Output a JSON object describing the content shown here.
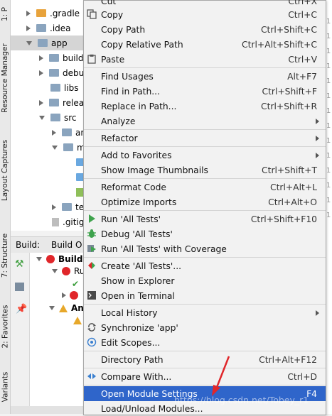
{
  "side_tabs": {
    "project": "1: P",
    "resource_manager": "Resource Manager",
    "layout_captures": "Layout Captures",
    "structure": "7: Structure",
    "favorites": "2: Favorites",
    "variants": "Variants"
  },
  "tree": {
    "items": [
      {
        "label": ".gradle",
        "folder": "orange",
        "arrow": "right"
      },
      {
        "label": ".idea",
        "folder": "gray",
        "arrow": "right"
      },
      {
        "label": "app",
        "folder": "gray",
        "arrow": "down"
      },
      {
        "label": "build",
        "folder": "gray",
        "arrow": "right"
      },
      {
        "label": "debu",
        "folder": "gray",
        "arrow": "right"
      },
      {
        "label": "libs",
        "folder": "gray",
        "arrow": "none"
      },
      {
        "label": "relea",
        "folder": "gray",
        "arrow": "right"
      },
      {
        "label": "src",
        "folder": "gray",
        "arrow": "down"
      },
      {
        "label": "an",
        "folder": "gray",
        "arrow": "right"
      },
      {
        "label": "m",
        "folder": "gray",
        "arrow": "down"
      },
      {
        "label": "te",
        "folder": "gray",
        "arrow": "right"
      },
      {
        "label": ".gitig",
        "folder": "file",
        "arrow": "none"
      }
    ]
  },
  "build": {
    "tab_build": "Build:",
    "tab_output": "Build O",
    "rows": [
      "Build",
      "Ru",
      "An"
    ]
  },
  "gutter_numbers": [
    "1",
    "1",
    "1",
    "1",
    "1",
    "1",
    "1",
    "1",
    "1",
    "1",
    "1",
    "1",
    "1",
    "1"
  ],
  "menu": {
    "items": [
      {
        "label": "Cut",
        "shortcut": "Ctrl+X"
      },
      {
        "label": "Copy",
        "shortcut": "Ctrl+C"
      },
      {
        "label": "Copy Path",
        "shortcut": "Ctrl+Shift+C"
      },
      {
        "label": "Copy Relative Path",
        "shortcut": "Ctrl+Alt+Shift+C"
      },
      {
        "label": "Paste",
        "shortcut": "Ctrl+V"
      },
      {
        "label": "Find Usages",
        "shortcut": "Alt+F7"
      },
      {
        "label": "Find in Path...",
        "shortcut": "Ctrl+Shift+F"
      },
      {
        "label": "Replace in Path...",
        "shortcut": "Ctrl+Shift+R"
      },
      {
        "label": "Analyze",
        "shortcut": ""
      },
      {
        "label": "Refactor",
        "shortcut": ""
      },
      {
        "label": "Add to Favorites",
        "shortcut": ""
      },
      {
        "label": "Show Image Thumbnails",
        "shortcut": "Ctrl+Shift+T"
      },
      {
        "label": "Reformat Code",
        "shortcut": "Ctrl+Alt+L"
      },
      {
        "label": "Optimize Imports",
        "shortcut": "Ctrl+Alt+O"
      },
      {
        "label": "Run 'All Tests'",
        "shortcut": "Ctrl+Shift+F10"
      },
      {
        "label": "Debug 'All Tests'",
        "shortcut": ""
      },
      {
        "label": "Run 'All Tests' with Coverage",
        "shortcut": ""
      },
      {
        "label": "Create 'All Tests'...",
        "shortcut": ""
      },
      {
        "label": "Show in Explorer",
        "shortcut": ""
      },
      {
        "label": "Open in Terminal",
        "shortcut": ""
      },
      {
        "label": "Local History",
        "shortcut": ""
      },
      {
        "label": "Synchronize 'app'",
        "shortcut": ""
      },
      {
        "label": "Edit Scopes...",
        "shortcut": ""
      },
      {
        "label": "Directory Path",
        "shortcut": "Ctrl+Alt+F12"
      },
      {
        "label": "Compare With...",
        "shortcut": "Ctrl+D"
      },
      {
        "label": "Open Module Settings",
        "shortcut": "F4"
      },
      {
        "label": "Load/Unload Modules...",
        "shortcut": ""
      }
    ]
  },
  "watermark": "https://blog.csdn.net/Tobey_r1",
  "colors": {
    "selection": "#2f65ca",
    "accent_red": "#e0262a"
  }
}
